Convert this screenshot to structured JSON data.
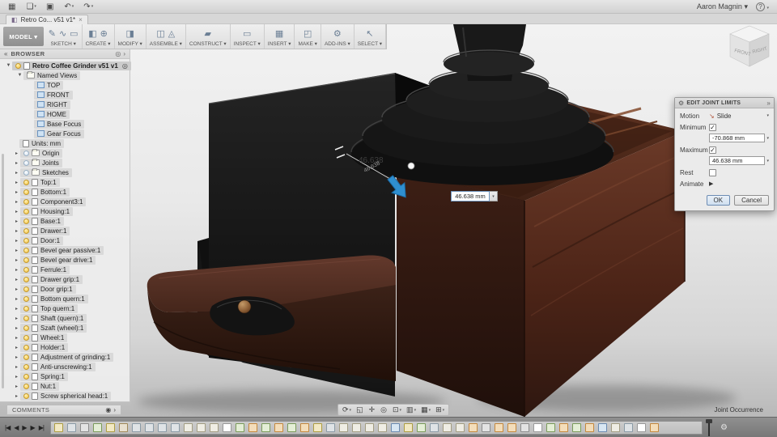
{
  "titlebar": {
    "user": "Aaron Magnin ▾",
    "help_glyph": "?",
    "icons": [
      {
        "name": "app-grid-icon",
        "glyph": "▦",
        "caret": ""
      },
      {
        "name": "file-new-icon",
        "glyph": "❏",
        "caret": "▾"
      },
      {
        "name": "save-icon",
        "glyph": "▣",
        "caret": ""
      },
      {
        "name": "undo-icon",
        "glyph": "↶",
        "caret": "▾"
      },
      {
        "name": "redo-icon",
        "glyph": "↷",
        "caret": "▾"
      }
    ]
  },
  "tab": {
    "title": "Retro Co... v51 v1*",
    "cube_glyph": "◧",
    "close_glyph": "×"
  },
  "toolbar": {
    "model_label": "MODEL ▾",
    "groups": [
      {
        "label": "SKETCH ▾",
        "icons": [
          "✎",
          "∿",
          "▭"
        ]
      },
      {
        "label": "CREATE ▾",
        "icons": [
          "◧",
          "⊕"
        ]
      },
      {
        "label": "MODIFY ▾",
        "icons": [
          "◨"
        ]
      },
      {
        "label": "ASSEMBLE ▾",
        "icons": [
          "◫",
          "◬"
        ]
      },
      {
        "label": "CONSTRUCT ▾",
        "icons": [
          "▰"
        ]
      },
      {
        "label": "INSPECT ▾",
        "icons": [
          "▭"
        ]
      },
      {
        "label": "INSERT ▾",
        "icons": [
          "▦"
        ]
      },
      {
        "label": "MAKE ▾",
        "icons": [
          "◰"
        ]
      },
      {
        "label": "ADD-INS ▾",
        "icons": [
          "⚙"
        ]
      },
      {
        "label": "SELECT ▾",
        "icons": [
          "↖"
        ]
      }
    ]
  },
  "browser": {
    "title": "BROWSER",
    "collapse_glyph": "«",
    "filter_glyph": "◎",
    "expand_glyph": "›",
    "root_label": "Retro Coffee Grinder v51 v1",
    "root_target_glyph": "◎",
    "named_views_label": "Named Views",
    "views": [
      "TOP",
      "FRONT",
      "RIGHT",
      "HOME",
      "Base Focus",
      "Gear Focus"
    ],
    "units_label": "Units: mm",
    "folders": [
      {
        "label": "Origin",
        "bulb": "off"
      },
      {
        "label": "Joints",
        "bulb": "off"
      },
      {
        "label": "Sketches",
        "bulb": "off"
      }
    ],
    "components": [
      {
        "label": "Top:1",
        "bulb": "on"
      },
      {
        "label": "Bottom:1",
        "bulb": "on"
      },
      {
        "label": "Component3:1",
        "bulb": "on"
      },
      {
        "label": "Housing:1",
        "bulb": "on"
      },
      {
        "label": "Base:1",
        "bulb": "on"
      },
      {
        "label": "Drawer:1",
        "bulb": "on"
      },
      {
        "label": "Door:1",
        "bulb": "on"
      },
      {
        "label": "Bevel gear passive:1",
        "bulb": "on"
      },
      {
        "label": "Bevel gear drive:1",
        "bulb": "on"
      },
      {
        "label": "Ferrule:1",
        "bulb": "on"
      },
      {
        "label": "Drawer grip:1",
        "bulb": "on"
      },
      {
        "label": "Door grip:1",
        "bulb": "on"
      },
      {
        "label": "Bottom quern:1",
        "bulb": "on"
      },
      {
        "label": "Top quern:1",
        "bulb": "on"
      },
      {
        "label": "Shaft (quern):1",
        "bulb": "on"
      },
      {
        "label": "Szaft (wheel):1",
        "bulb": "on"
      },
      {
        "label": "Wheel:1",
        "bulb": "on"
      },
      {
        "label": "Holder:1",
        "bulb": "on"
      },
      {
        "label": "Adjustment of grinding:1",
        "bulb": "on"
      },
      {
        "label": "Anti-unscrewing:1",
        "bulb": "on"
      },
      {
        "label": "Spring:1",
        "bulb": "on"
      },
      {
        "label": "Nut:1",
        "bulb": "on"
      },
      {
        "label": "Screw spherical head:1",
        "bulb": "on"
      }
    ],
    "comments_label": "COMMENTS",
    "comments_icon_glyph": "◉",
    "comments_expand_glyph": "›"
  },
  "dialog": {
    "title": "EDIT JOINT LIMITS",
    "gear_glyph": "⚙",
    "chevrons_glyph": "»",
    "motion_label": "Motion",
    "motion_icon_glyph": "↘",
    "motion_value": "Slide",
    "minimum_label": "Minimum",
    "minimum_checked_glyph": "✓",
    "minimum_value": "-70.868 mm",
    "maximum_label": "Maximum",
    "maximum_checked_glyph": "✓",
    "maximum_value": "46.638 mm",
    "rest_label": "Rest",
    "animate_label": "Animate",
    "animate_play_glyph": "▶",
    "ok_label": "OK",
    "cancel_label": "Cancel"
  },
  "viewport": {
    "dimension_label": "46.638",
    "dimension_sub_label": "46.638",
    "dimension_input_value": "46.638 mm",
    "status_hint": "Joint Occurrence",
    "viewcube": {
      "front": "FRONT",
      "right": "RIGHT"
    }
  },
  "navbar": {
    "items": [
      {
        "name": "orbit-icon",
        "glyph": "⟳",
        "caret": "▾"
      },
      {
        "name": "look-at-icon",
        "glyph": "◱",
        "caret": ""
      },
      {
        "name": "pan-icon",
        "glyph": "✛",
        "caret": ""
      },
      {
        "name": "zoom-icon",
        "glyph": "◎",
        "caret": ""
      },
      {
        "name": "fit-icon",
        "glyph": "⊡",
        "caret": "▾"
      },
      {
        "name": "display-settings-icon",
        "glyph": "▥",
        "caret": "▾"
      },
      {
        "name": "grid-layout-icon",
        "glyph": "▦",
        "caret": "▾"
      },
      {
        "name": "viewports-icon",
        "glyph": "⊞",
        "caret": "▾"
      }
    ]
  },
  "timeline": {
    "controls": [
      {
        "name": "go-to-start-icon",
        "glyph": "|◀"
      },
      {
        "name": "step-back-icon",
        "glyph": "◀"
      },
      {
        "name": "step-forward-icon",
        "glyph": "▶"
      },
      {
        "name": "play-icon",
        "glyph": "▶"
      },
      {
        "name": "go-to-end-icon",
        "glyph": "▶|"
      }
    ],
    "gear_glyph": "⚙",
    "items": [
      "comp",
      "body",
      "spring",
      "sketch",
      "comp",
      "pair",
      "body",
      "body",
      "body",
      "body",
      "doc",
      "doc",
      "doc",
      "docw",
      "sketch",
      "joint",
      "sketch",
      "joint",
      "sketch",
      "joint",
      "comp",
      "body",
      "doc",
      "doc",
      "doc",
      "doc",
      "feature",
      "comp",
      "sketch",
      "body",
      "doc",
      "doc",
      "joint",
      "spring",
      "joint",
      "joint",
      "spring",
      "docw",
      "sketch",
      "joint",
      "sketch",
      "joint",
      "feature",
      "doc",
      "body",
      "docw",
      "joint"
    ]
  }
}
